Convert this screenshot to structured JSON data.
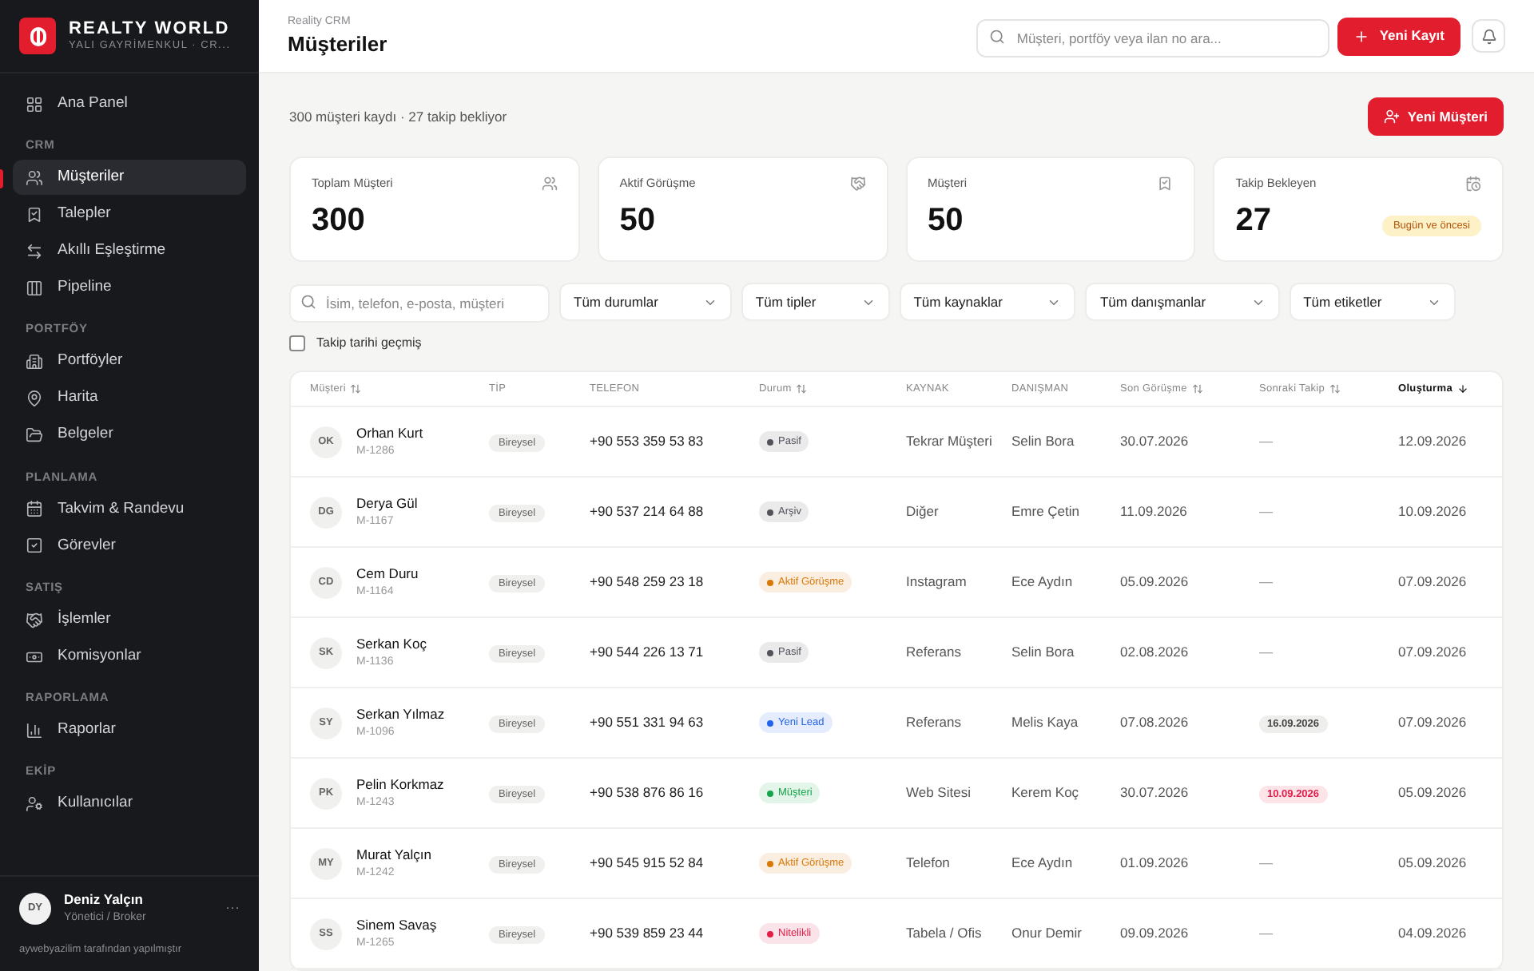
{
  "brand": {
    "name": "REALTY WORLD",
    "subtitle": "YALI GAYRİMENKUL · CR..."
  },
  "sidebar": {
    "sections": [
      {
        "items": [
          {
            "label": "Ana Panel",
            "selected": false
          }
        ]
      },
      {
        "title": "CRM",
        "items": [
          {
            "label": "Müşteriler",
            "selected": true
          },
          {
            "label": "Talepler",
            "selected": false
          },
          {
            "label": "Akıllı Eşleştirme",
            "selected": false
          },
          {
            "label": "Pipeline",
            "selected": false
          }
        ]
      },
      {
        "title": "PORTFÖY",
        "items": [
          {
            "label": "Portföyler",
            "selected": false
          },
          {
            "label": "Harita",
            "selected": false
          },
          {
            "label": "Belgeler",
            "selected": false
          }
        ]
      },
      {
        "title": "PLANLAMA",
        "items": [
          {
            "label": "Takvim & Randevu",
            "selected": false
          },
          {
            "label": "Görevler",
            "selected": false
          }
        ]
      },
      {
        "title": "SATIŞ",
        "items": [
          {
            "label": "İşlemler",
            "selected": false
          },
          {
            "label": "Komisyonlar",
            "selected": false
          }
        ]
      },
      {
        "title": "RAPORLAMA",
        "items": [
          {
            "label": "Raporlar",
            "selected": false
          }
        ]
      },
      {
        "title": "EKİP",
        "items": [
          {
            "label": "Kullanıcılar",
            "selected": false
          }
        ]
      }
    ],
    "user": {
      "initials": "DY",
      "name": "Deniz Yalçın",
      "role": "Yönetici / Broker",
      "more": "···"
    },
    "footer": "aywebyazilim tarafından yapılmıştır"
  },
  "header": {
    "breadcrumb": "Reality CRM",
    "title": "Müşteriler",
    "search_placeholder": "Müşteri, portföy veya ilan no ara...",
    "new_button": "Yeni Kayıt"
  },
  "summary": "300 müşteri kaydı · 27 takip bekliyor",
  "new_customer_button": "Yeni Müşteri",
  "stats": [
    {
      "label": "Toplam Müşteri",
      "value": "300"
    },
    {
      "label": "Aktif Görüşme",
      "value": "50"
    },
    {
      "label": "Müşteri",
      "value": "50"
    },
    {
      "label": "Takip Bekleyen",
      "value": "27",
      "badge": "Bugün ve öncesi"
    }
  ],
  "filters": {
    "search_placeholder": "İsim, telefon, e-posta, müşteri",
    "dropdowns": [
      "Tüm durumlar",
      "Tüm tipler",
      "Tüm kaynaklar",
      "Tüm danışmanlar",
      "Tüm etiketler"
    ],
    "overdue": {
      "label": "Takip tarihi geçmiş",
      "checked": false
    }
  },
  "table": {
    "columns": [
      {
        "label": "Müşteri",
        "sortable": true,
        "active": false
      },
      {
        "label": "TİP",
        "sortable": false,
        "active": false
      },
      {
        "label": "TELEFON",
        "sortable": false,
        "active": false
      },
      {
        "label": "Durum",
        "sortable": true,
        "active": false
      },
      {
        "label": "KAYNAK",
        "sortable": false,
        "active": false
      },
      {
        "label": "DANIŞMAN",
        "sortable": false,
        "active": false
      },
      {
        "label": "Son Görüşme",
        "sortable": true,
        "active": false
      },
      {
        "label": "Sonraki Takip",
        "sortable": true,
        "active": false
      },
      {
        "label": "Oluşturma",
        "sortable": true,
        "active": true
      }
    ],
    "rows": [
      {
        "initials": "OK",
        "name": "Orhan Kurt",
        "code": "M-1286",
        "type": "Bireysel",
        "phone": "+90 553 359 53 83",
        "status": {
          "label": "Pasif",
          "color": "#52525b"
        },
        "source": "Tekrar Müşteri",
        "advisor": "Selin Bora",
        "last_meeting": "30.07.2026",
        "next_follow_up": {
          "text": "—",
          "kind": "none"
        },
        "created": "12.09.2026"
      },
      {
        "initials": "DG",
        "name": "Derya Gül",
        "code": "M-1167",
        "type": "Bireysel",
        "phone": "+90 537 214 64 88",
        "status": {
          "label": "Arşiv",
          "color": "#52525b"
        },
        "source": "Diğer",
        "advisor": "Emre Çetin",
        "last_meeting": "11.09.2026",
        "next_follow_up": {
          "text": "—",
          "kind": "none"
        },
        "created": "10.09.2026"
      },
      {
        "initials": "CD",
        "name": "Cem Duru",
        "code": "M-1164",
        "type": "Bireysel",
        "phone": "+90 548 259 23 18",
        "status": {
          "label": "Aktif Görüşme",
          "color": "#d97706"
        },
        "source": "Instagram",
        "advisor": "Ece Aydın",
        "last_meeting": "05.09.2026",
        "next_follow_up": {
          "text": "—",
          "kind": "none"
        },
        "created": "07.09.2026"
      },
      {
        "initials": "SK",
        "name": "Serkan Koç",
        "code": "M-1136",
        "type": "Bireysel",
        "phone": "+90 544 226 13 71",
        "status": {
          "label": "Pasif",
          "color": "#52525b"
        },
        "source": "Referans",
        "advisor": "Selin Bora",
        "last_meeting": "02.08.2026",
        "next_follow_up": {
          "text": "—",
          "kind": "none"
        },
        "created": "07.09.2026"
      },
      {
        "initials": "SY",
        "name": "Serkan Yılmaz",
        "code": "M-1096",
        "type": "Bireysel",
        "phone": "+90 551 331 94 63",
        "status": {
          "label": "Yeni Lead",
          "color": "#2563eb"
        },
        "source": "Referans",
        "advisor": "Melis Kaya",
        "last_meeting": "07.08.2026",
        "next_follow_up": {
          "text": "16.09.2026",
          "kind": "scheduled"
        },
        "created": "07.09.2026"
      },
      {
        "initials": "PK",
        "name": "Pelin Korkmaz",
        "code": "M-1243",
        "type": "Bireysel",
        "phone": "+90 538 876 86 16",
        "status": {
          "label": "Müşteri",
          "color": "#16a34a"
        },
        "source": "Web Sitesi",
        "advisor": "Kerem Koç",
        "last_meeting": "30.07.2026",
        "next_follow_up": {
          "text": "10.09.2026",
          "kind": "overdue"
        },
        "created": "05.09.2026"
      },
      {
        "initials": "MY",
        "name": "Murat Yalçın",
        "code": "M-1242",
        "type": "Bireysel",
        "phone": "+90 545 915 52 84",
        "status": {
          "label": "Aktif Görüşme",
          "color": "#d97706"
        },
        "source": "Telefon",
        "advisor": "Ece Aydın",
        "last_meeting": "01.09.2026",
        "next_follow_up": {
          "text": "—",
          "kind": "none"
        },
        "created": "05.09.2026"
      },
      {
        "initials": "SS",
        "name": "Sinem Savaş",
        "code": "M-1265",
        "type": "Bireysel",
        "phone": "+90 539 859 23 44",
        "status": {
          "label": "Nitelikli",
          "color": "#e11d48"
        },
        "source": "Tabela / Ofis",
        "advisor": "Onur Demir",
        "last_meeting": "09.09.2026",
        "next_follow_up": {
          "text": "—",
          "kind": "none"
        },
        "created": "04.09.2026"
      }
    ]
  }
}
